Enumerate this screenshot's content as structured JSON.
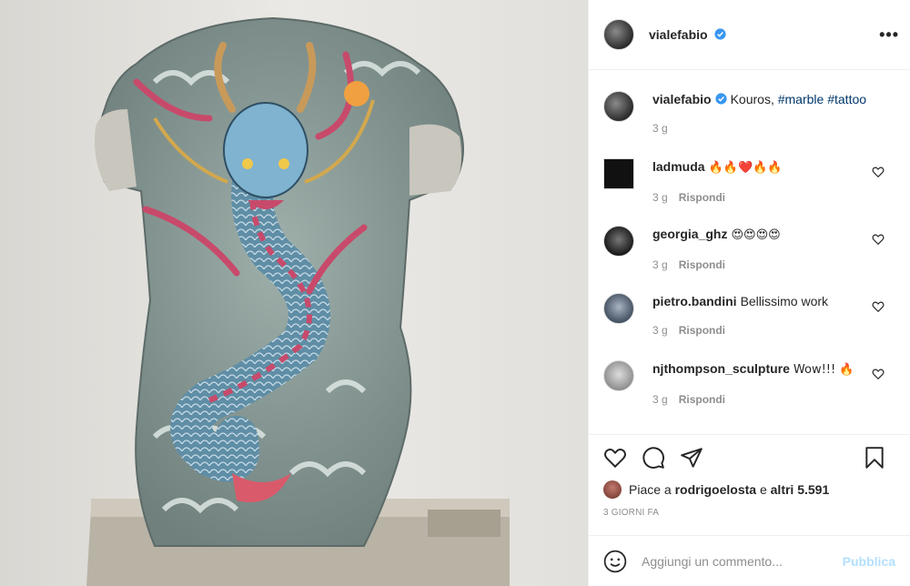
{
  "post": {
    "author": "vialefabio",
    "more_label": "•••",
    "image_alt": "Tattooed marble torso sculpture with a dragon"
  },
  "caption": {
    "username": "vialefabio",
    "text_before": "Kouros, ",
    "tag1": "#marble",
    "tag2": "#tattoo",
    "time": "3 g"
  },
  "comments": [
    {
      "username": "ladmuda",
      "text": "🔥🔥❤️🔥🔥",
      "time": "3 g",
      "reply": "Rispondi"
    },
    {
      "username": "georgia_ghz",
      "text": "😍😍😍😍",
      "time": "3 g",
      "reply": "Rispondi"
    },
    {
      "username": "pietro.bandini",
      "text": "Bellissimo work",
      "time": "3 g",
      "reply": "Rispondi"
    },
    {
      "username": "njthompson_sculpture",
      "text": "Wow!!! 🔥",
      "time": "3 g",
      "reply": "Rispondi"
    }
  ],
  "likes": {
    "prefix": "Piace a ",
    "liker": "rodrigoelosta",
    "middle": " e ",
    "others": "altri 5.591"
  },
  "post_time": "3 GIORNI FA",
  "add_comment": {
    "placeholder": "Aggiungi un commento...",
    "publish": "Pubblica"
  },
  "colors": {
    "verified": "#3897f0",
    "link": "#00376b",
    "publish_disabled": "#b2dffc",
    "muted": "#8e8e8e"
  },
  "icons": [
    "more-icon",
    "verified-icon",
    "heart-icon",
    "comment-icon",
    "share-icon",
    "bookmark-icon",
    "emoji-icon"
  ]
}
